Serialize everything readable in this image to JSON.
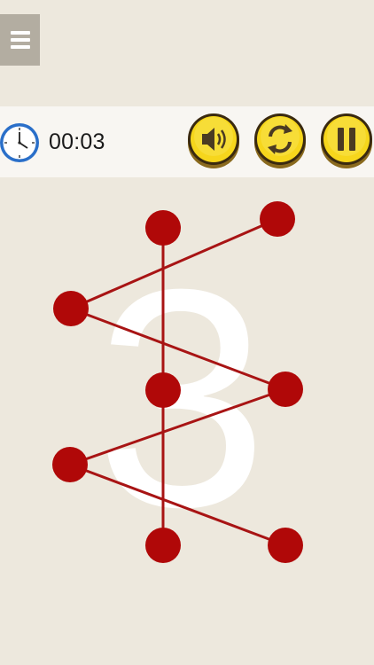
{
  "menu": {
    "icon": "hamburger-menu-icon"
  },
  "hud": {
    "timer_icon": "clock-icon",
    "timer": "00:03",
    "buttons": [
      {
        "name": "sound-button",
        "icon": "speaker-icon"
      },
      {
        "name": "restart-button",
        "icon": "refresh-icon"
      },
      {
        "name": "pause-button",
        "icon": "pause-icon"
      }
    ]
  },
  "level": {
    "number": "3",
    "dot_color": "#b00808",
    "line_color": "#a81414",
    "accent_color": "#f6d61c"
  }
}
